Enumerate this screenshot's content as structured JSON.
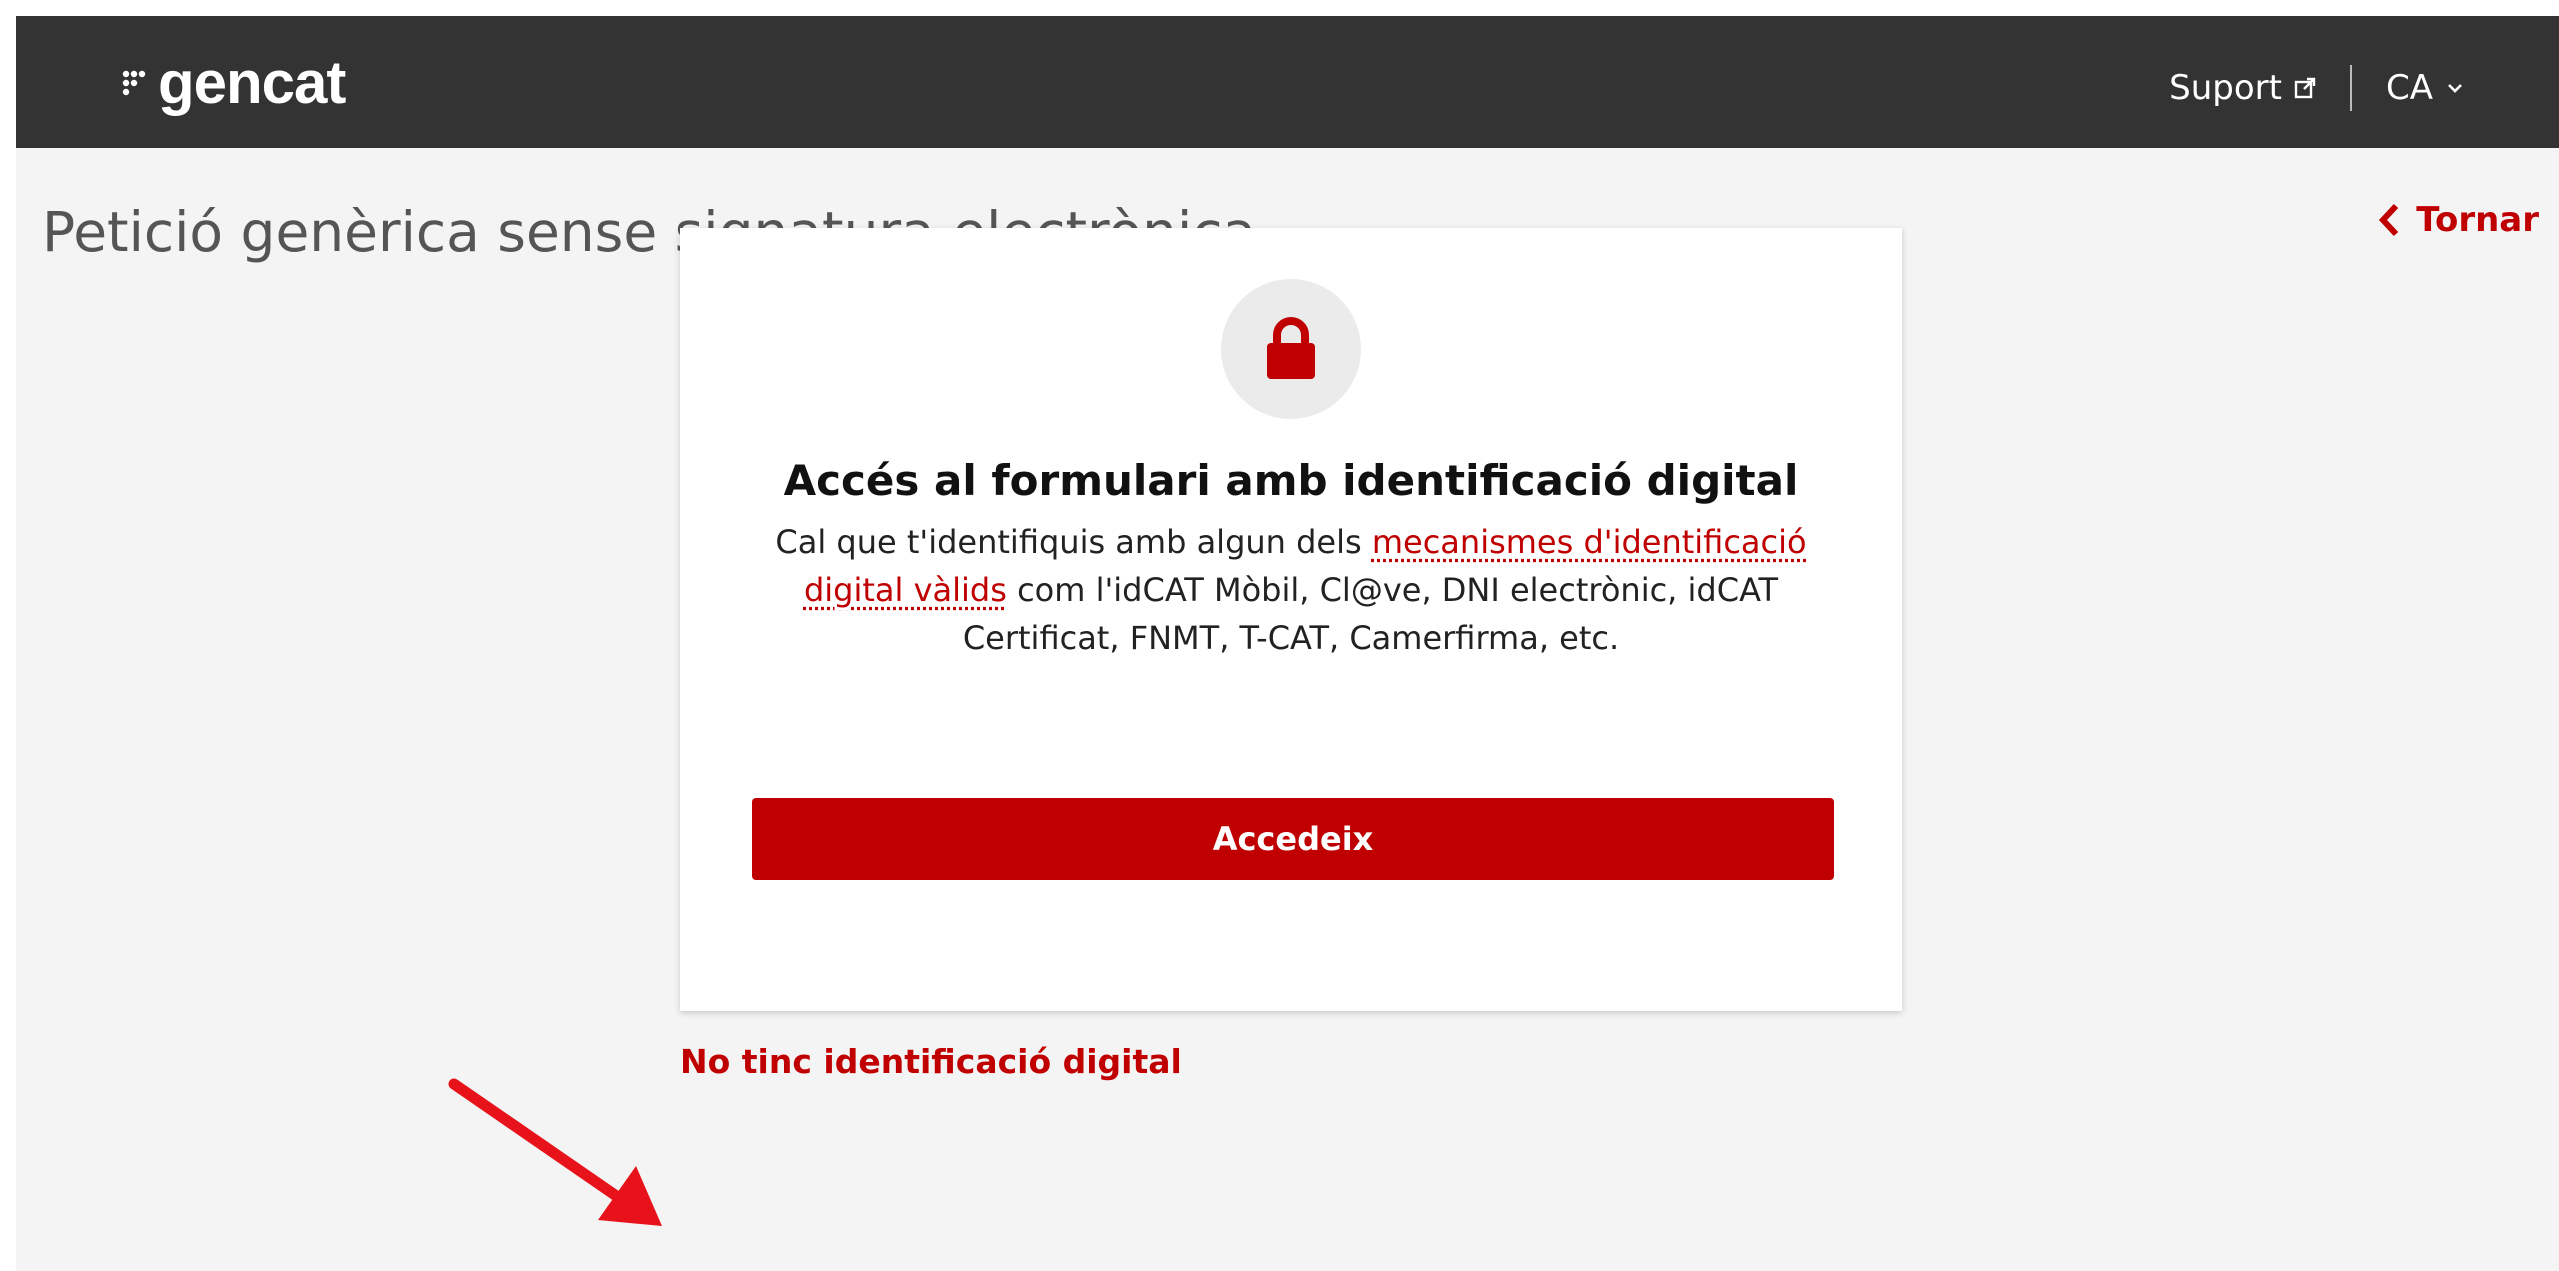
{
  "header": {
    "logo_text": "gencat",
    "suport_label": "Suport",
    "language_label": "CA"
  },
  "page": {
    "title": "Petició genèrica sense signatura electrònica",
    "back_label": "Tornar"
  },
  "card": {
    "title": "Accés al formulari amb identificació digital",
    "desc_before": "Cal que t'identifiquis amb algun dels ",
    "desc_link": "mecanismes d'identificació digital vàlids",
    "desc_after": " com l'idCAT Mòbil, Cl@ve, DNI electrònic, idCAT Certificat, FNMT, T-CAT, Camerfirma, etc.",
    "button_label": "Accedeix"
  },
  "no_id_link": "No tinc identificació digital",
  "colors": {
    "brand_red": "#c00000",
    "header_bg": "#333333",
    "page_bg": "#f4f4f4",
    "annotation_red": "#e8121a"
  },
  "icons": [
    "gencat-logo-icon",
    "external-link-icon",
    "chevron-down-icon",
    "chevron-left-icon",
    "lock-icon",
    "annotation-arrow-icon"
  ]
}
